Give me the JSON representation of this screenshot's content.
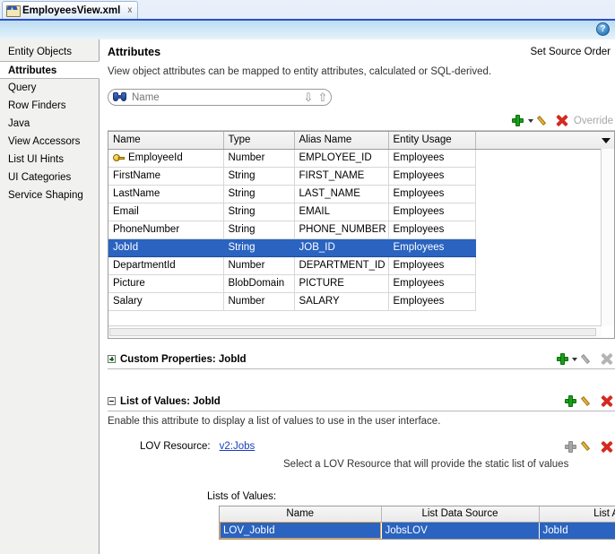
{
  "tab": {
    "title": "EmployeesView.xml",
    "close_label": "x",
    "icon": "xml-file-icon"
  },
  "help": {
    "label": "?"
  },
  "sidebar": {
    "items": [
      {
        "label": "Entity Objects",
        "selected": false
      },
      {
        "label": "Attributes",
        "selected": true
      },
      {
        "label": "Query",
        "selected": false
      },
      {
        "label": "Row Finders",
        "selected": false
      },
      {
        "label": "Java",
        "selected": false
      },
      {
        "label": "View Accessors",
        "selected": false
      },
      {
        "label": "List UI Hints",
        "selected": false
      },
      {
        "label": "UI Categories",
        "selected": false
      },
      {
        "label": "Service Shaping",
        "selected": false
      }
    ]
  },
  "page": {
    "title": "Attributes",
    "set_source_order": "Set Source Order",
    "subtitle": "View object attributes can be mapped to entity attributes, calculated or SQL-derived."
  },
  "search": {
    "placeholder": "Name",
    "icon": "binoculars-icon",
    "down_arrow": "⇩",
    "up_arrow": "⇧"
  },
  "attributes_toolbar": {
    "add_label": "Add",
    "dropdown_label": "Add options",
    "edit_label": "Edit",
    "delete_label": "Delete",
    "override_label": "Override"
  },
  "attributes_table": {
    "columns": [
      "Name",
      "Type",
      "Alias Name",
      "Entity Usage",
      ""
    ],
    "rows": [
      {
        "name": "EmployeeId",
        "type": "Number",
        "alias": "EMPLOYEE_ID",
        "usage": "Employees",
        "key": true,
        "selected": false
      },
      {
        "name": "FirstName",
        "type": "String",
        "alias": "FIRST_NAME",
        "usage": "Employees",
        "key": false,
        "selected": false
      },
      {
        "name": "LastName",
        "type": "String",
        "alias": "LAST_NAME",
        "usage": "Employees",
        "key": false,
        "selected": false
      },
      {
        "name": "Email",
        "type": "String",
        "alias": "EMAIL",
        "usage": "Employees",
        "key": false,
        "selected": false
      },
      {
        "name": "PhoneNumber",
        "type": "String",
        "alias": "PHONE_NUMBER",
        "usage": "Employees",
        "key": false,
        "selected": false
      },
      {
        "name": "JobId",
        "type": "String",
        "alias": "JOB_ID",
        "usage": "Employees",
        "key": false,
        "selected": true
      },
      {
        "name": "DepartmentId",
        "type": "Number",
        "alias": "DEPARTMENT_ID",
        "usage": "Employees",
        "key": false,
        "selected": false
      },
      {
        "name": "Picture",
        "type": "BlobDomain",
        "alias": "PICTURE",
        "usage": "Employees",
        "key": false,
        "selected": false
      },
      {
        "name": "Salary",
        "type": "Number",
        "alias": "SALARY",
        "usage": "Employees",
        "key": false,
        "selected": false
      }
    ]
  },
  "custom_properties": {
    "title": "Custom Properties: JobId",
    "expanded": false
  },
  "list_of_values": {
    "title": "List of Values: JobId",
    "expanded": true,
    "description": "Enable this attribute to display a list of values to use in the user interface.",
    "lov_resource_label": "LOV Resource:",
    "lov_resource_value": "v2:Jobs",
    "lov_resource_hint": "Select a LOV Resource that will provide the static list of values",
    "lists_label": "Lists of Values:",
    "columns": [
      "Name",
      "List Data Source",
      "List Attribute"
    ],
    "rows": [
      {
        "name": "LOV_JobId",
        "source": "JobsLOV",
        "attribute": "JobId",
        "selected": true
      }
    ]
  },
  "colors": {
    "selection_blue": "#2a63c0",
    "link_blue": "#1a3fbf",
    "accent_border": "#2b4fc4",
    "add_green": "#19a019",
    "delete_red": "#d42a20",
    "focus_orange": "#e8a33d"
  }
}
